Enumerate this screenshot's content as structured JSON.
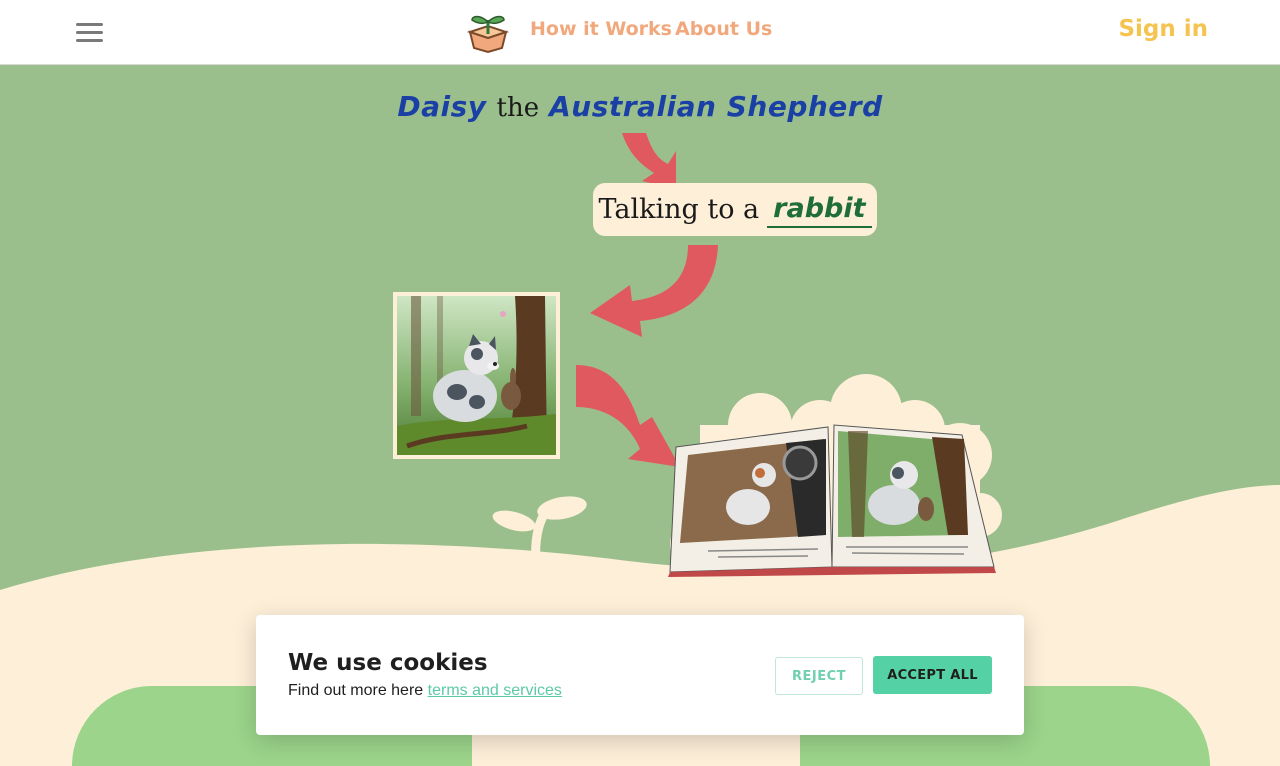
{
  "header": {
    "nav": {
      "how_it_works": "How it Works",
      "about_us": "About Us"
    },
    "sign_in": "Sign in"
  },
  "hero": {
    "title": {
      "name": "Daisy",
      "connector": "the",
      "breed": "Australian Shepherd"
    },
    "activity": {
      "prefix": "Talking to a",
      "animal": "rabbit"
    }
  },
  "cookie_banner": {
    "title": "We use cookies",
    "text": "Find out more here",
    "link": "terms and services",
    "reject_label": "REJECT",
    "accept_label": "ACCEPT ALL"
  },
  "colors": {
    "hero_bg": "#9bbf8c",
    "cream": "#fdefd8",
    "nav_link": "#f0a87c",
    "sign_in": "#f5c350",
    "arrow": "#e0595f",
    "title_blue": "#1a40a6",
    "animal_green": "#1f6e3a",
    "accept_button": "#55d1a6"
  },
  "icons": {
    "menu": "hamburger-menu-icon",
    "logo": "sprout-box-logo"
  }
}
